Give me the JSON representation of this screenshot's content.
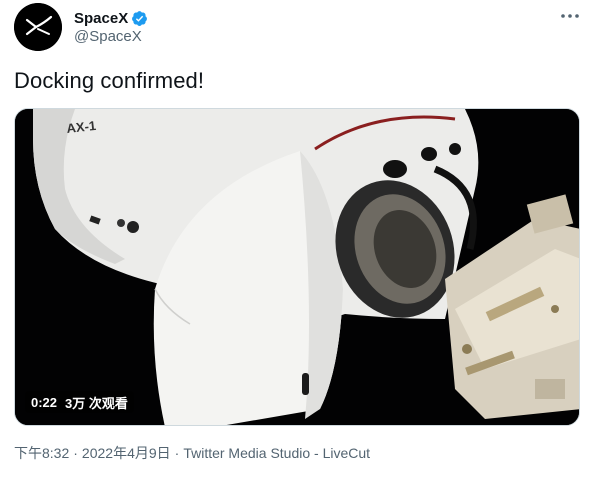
{
  "account": {
    "display_name": "SpaceX",
    "handle": "@SpaceX",
    "verified": true,
    "avatar_icon": "spacex-logo-icon"
  },
  "tweet": {
    "text": "Docking confirmed!",
    "more_icon": "more-options-icon"
  },
  "media": {
    "type": "video",
    "duration": "0:22",
    "views": "3万 次观看",
    "capsule_label": "AX-1"
  },
  "meta": {
    "time": "下午8:32",
    "date": "2022年4月9日",
    "separator": "·",
    "source": "Twitter Media Studio - LiveCut"
  },
  "colors": {
    "text_primary": "#0f1419",
    "text_secondary": "#536471",
    "verified_blue": "#1d9bf0"
  }
}
